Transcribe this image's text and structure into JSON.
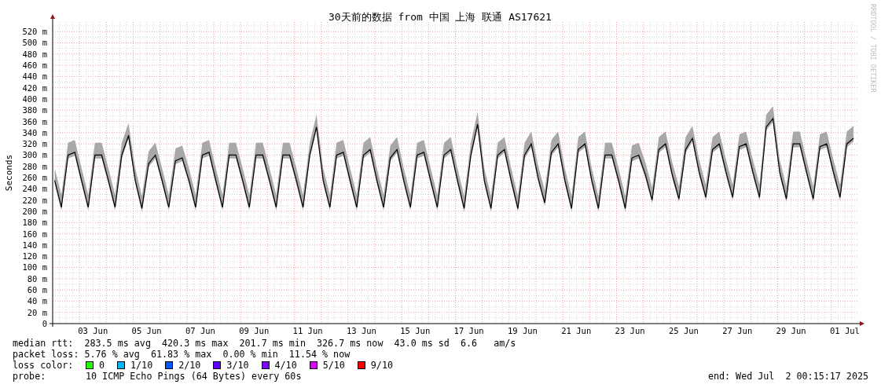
{
  "chart": {
    "watermark": "RRDTOOL / TOBI OETIKER",
    "chart_data": {
      "type": "line",
      "grid": true,
      "title": "30天前的数据 from 中国 上海 联通 AS17621",
      "ylabel": "Seconds",
      "ylim": [
        0,
        537
      ],
      "yticks": [
        {
          "value": 0,
          "label": "0"
        },
        {
          "value": 20,
          "label": "20 m"
        },
        {
          "value": 40,
          "label": "40 m"
        },
        {
          "value": 60,
          "label": "60 m"
        },
        {
          "value": 80,
          "label": "80 m"
        },
        {
          "value": 100,
          "label": "100 m"
        },
        {
          "value": 120,
          "label": "120 m"
        },
        {
          "value": 140,
          "label": "140 m"
        },
        {
          "value": 160,
          "label": "160 m"
        },
        {
          "value": 180,
          "label": "180 m"
        },
        {
          "value": 200,
          "label": "200 m"
        },
        {
          "value": 220,
          "label": "220 m"
        },
        {
          "value": 240,
          "label": "240 m"
        },
        {
          "value": 260,
          "label": "260 m"
        },
        {
          "value": 280,
          "label": "280 m"
        },
        {
          "value": 300,
          "label": "300 m"
        },
        {
          "value": 320,
          "label": "320 m"
        },
        {
          "value": 340,
          "label": "340 m"
        },
        {
          "value": 360,
          "label": "360 m"
        },
        {
          "value": 380,
          "label": "380 m"
        },
        {
          "value": 400,
          "label": "400 m"
        },
        {
          "value": 420,
          "label": "420 m"
        },
        {
          "value": 440,
          "label": "440 m"
        },
        {
          "value": 460,
          "label": "460 m"
        },
        {
          "value": 480,
          "label": "480 m"
        },
        {
          "value": 500,
          "label": "500 m"
        },
        {
          "value": 520,
          "label": "520 m"
        }
      ],
      "categories": [
        null,
        null,
        null,
        null,
        null,
        null,
        "03 Jun",
        null,
        null,
        null,
        null,
        null,
        null,
        null,
        "05 Jun",
        null,
        null,
        null,
        null,
        null,
        null,
        null,
        "07 Jun",
        null,
        null,
        null,
        null,
        null,
        null,
        null,
        "09 Jun",
        null,
        null,
        null,
        null,
        null,
        null,
        null,
        "11 Jun",
        null,
        null,
        null,
        null,
        null,
        null,
        null,
        "13 Jun",
        null,
        null,
        null,
        null,
        null,
        null,
        null,
        "15 Jun",
        null,
        null,
        null,
        null,
        null,
        null,
        null,
        "17 Jun",
        null,
        null,
        null,
        null,
        null,
        null,
        null,
        "19 Jun",
        null,
        null,
        null,
        null,
        null,
        null,
        null,
        "21 Jun",
        null,
        null,
        null,
        null,
        null,
        null,
        null,
        "23 Jun",
        null,
        null,
        null,
        null,
        null,
        null,
        null,
        "25 Jun",
        null,
        null,
        null,
        null,
        null,
        null,
        null,
        "27 Jun",
        null,
        null,
        null,
        null,
        null,
        null,
        null,
        "29 Jun",
        null,
        null,
        null,
        null,
        null,
        null,
        null,
        "01 Jul",
        null
      ],
      "series": [
        {
          "color": "#000000",
          "values": [
            255,
            207,
            300,
            305,
            255,
            207,
            300,
            300,
            255,
            207,
            300,
            335,
            255,
            205,
            285,
            300,
            255,
            207,
            290,
            295,
            255,
            207,
            300,
            305,
            255,
            207,
            300,
            300,
            255,
            207,
            300,
            300,
            255,
            207,
            300,
            300,
            255,
            207,
            300,
            350,
            255,
            207,
            300,
            305,
            255,
            207,
            300,
            310,
            255,
            207,
            295,
            310,
            255,
            207,
            300,
            305,
            255,
            207,
            300,
            310,
            255,
            205,
            300,
            355,
            255,
            205,
            300,
            310,
            255,
            205,
            300,
            320,
            260,
            215,
            305,
            320,
            255,
            205,
            310,
            320,
            255,
            205,
            300,
            300,
            255,
            205,
            295,
            300,
            265,
            220,
            310,
            320,
            265,
            222,
            310,
            330,
            270,
            225,
            310,
            320,
            270,
            225,
            315,
            320,
            270,
            225,
            350,
            365,
            270,
            222,
            320,
            320,
            270,
            222,
            315,
            320,
            270,
            225,
            320,
            330
          ]
        }
      ]
    }
  },
  "legend": {
    "rows": [
      "median rtt:  283.5 ms avg  420.3 ms max  201.7 ms min  326.7 ms now  43.0 ms sd  6.6   am/s",
      "packet loss: 5.76 % avg  61.83 % max  0.00 % min  11.54 % now"
    ],
    "loss_color": {
      "label": "loss color:",
      "items": [
        {
          "label": "0",
          "color": "#26ff00"
        },
        {
          "label": "1/10",
          "color": "#00b8ff"
        },
        {
          "label": "2/10",
          "color": "#0059ff"
        },
        {
          "label": "3/10",
          "color": "#5e00ff"
        },
        {
          "label": "4/10",
          "color": "#7e00ff"
        },
        {
          "label": "5/10",
          "color": "#dd00ff"
        },
        {
          "label": "9/10",
          "color": "#ff0000"
        }
      ]
    },
    "probe": {
      "label": "probe:",
      "text": "10 ICMP Echo Pings (64 Bytes) every 60s"
    },
    "end": "end: Wed Jul  2 00:15:17 2025"
  }
}
